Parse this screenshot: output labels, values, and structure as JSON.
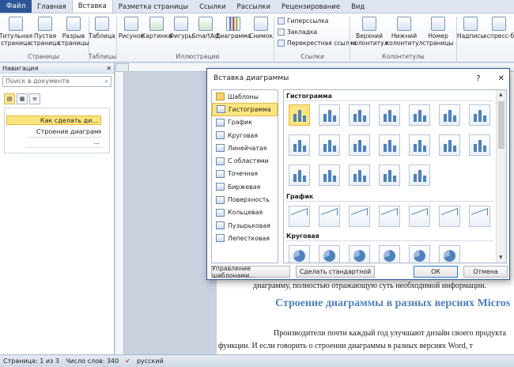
{
  "tabs": [
    "Файл",
    "Главная",
    "Вставка",
    "Разметка страницы",
    "Ссылки",
    "Рассылки",
    "Рецензирование",
    "Вид"
  ],
  "ribbon": {
    "pages": [
      "Титульная страница",
      "Пустая страница",
      "Разрыв страницы"
    ],
    "pages_group": "Страницы",
    "table": "Таблица",
    "tables_group": "Таблицы",
    "illus": [
      "Рисунок",
      "Картинка",
      "Фигуры",
      "SmartArt",
      "Диаграмма",
      "Снимок"
    ],
    "illus_group": "Иллюстрации",
    "links": [
      "Гиперссылка",
      "Закладка",
      "Перекрестная ссылка"
    ],
    "links_group": "Ссылки",
    "hf": [
      "Верхний колонтитул",
      "Нижний колонтитул",
      "Номер страницы"
    ],
    "hf_group": "Колонтитулы",
    "text": [
      "Надпись",
      "Экспресс-бл"
    ]
  },
  "nav": {
    "title": "Навигация",
    "search_placeholder": "Поиск в документе",
    "h1": "Как сделать ди...",
    "h2": "Строение диаграммы ...",
    "h3": "..."
  },
  "dialog": {
    "title": "Вставка диаграммы",
    "help": "?",
    "close": "✕",
    "categories": [
      "Шаблоны",
      "Гистограмма",
      "График",
      "Круговая",
      "Линейчатая",
      "С областями",
      "Точечная",
      "Биржевая",
      "Поверхность",
      "Кольцевая",
      "Пузырьковая",
      "Лепестковая"
    ],
    "selected": "Гистограмма",
    "sections": [
      "Гистограмма",
      "График",
      "Круговая"
    ],
    "manage_btn": "Управление шаблонами...",
    "default_btn": "Сделать стандартной",
    "ok": "ОК",
    "cancel": "Отмена"
  },
  "doc": {
    "line1": "диаграмму, полностью отражающую суть необходимой информации.",
    "heading": "Строение диаграммы в разных версиях Micros",
    "line2": "Производители почти каждый год улучшают дизайн своего продукта",
    "line3": "функции. И если говорить о строении диаграммы в разных версиях Word, т"
  },
  "status": {
    "page": "Страница: 1 из 3",
    "words": "Число слов: 340",
    "lang": "русский"
  }
}
